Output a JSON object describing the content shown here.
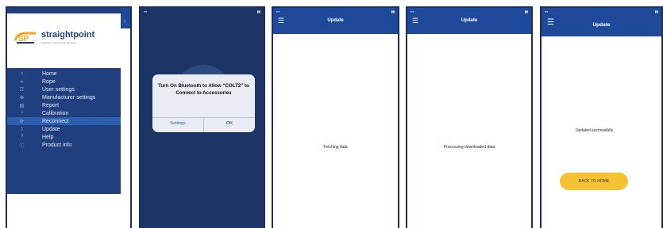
{
  "screens": {
    "menu": {
      "brand": "straightpoint",
      "tagline": "weighing, measuring & load cells",
      "items": [
        {
          "label": "Home",
          "icon": "home-icon",
          "glyph": "⌂"
        },
        {
          "label": "Rope",
          "icon": "rope-icon",
          "glyph": "━"
        },
        {
          "label": "User settings",
          "icon": "user-settings-icon",
          "glyph": "☷"
        },
        {
          "label": "Manufacturer settings",
          "icon": "manufacturer-settings-icon",
          "glyph": "⚙"
        },
        {
          "label": "Report",
          "icon": "report-icon",
          "glyph": "▤"
        },
        {
          "label": "Calibration",
          "icon": "calibration-icon",
          "glyph": "◔"
        },
        {
          "label": "Reconnect",
          "icon": "reconnect-icon",
          "glyph": "⟳"
        },
        {
          "label": "Update",
          "icon": "update-icon",
          "glyph": "⇪"
        },
        {
          "label": "Help",
          "icon": "help-icon",
          "glyph": "?"
        },
        {
          "label": "Product info",
          "icon": "info-icon",
          "glyph": "ⓘ"
        }
      ],
      "active_item": "Reconnect"
    },
    "bluetooth": {
      "message": "Turn On Bluetooth to Allow \"COLT2\" to Connect to Accessories",
      "settings_label": "Settings",
      "ok_label": "OK"
    },
    "fetching": {
      "title": "Update",
      "status": "Fetching data"
    },
    "processing": {
      "title": "Update",
      "status": "Processing downloaded data"
    },
    "done": {
      "title": "Update",
      "status": "Updated successfully",
      "back_label": "BACK TO HOME"
    }
  },
  "colors": {
    "primary": "#1f4a9b",
    "drawer": "#1f3f7f",
    "accent": "#f6c234"
  }
}
